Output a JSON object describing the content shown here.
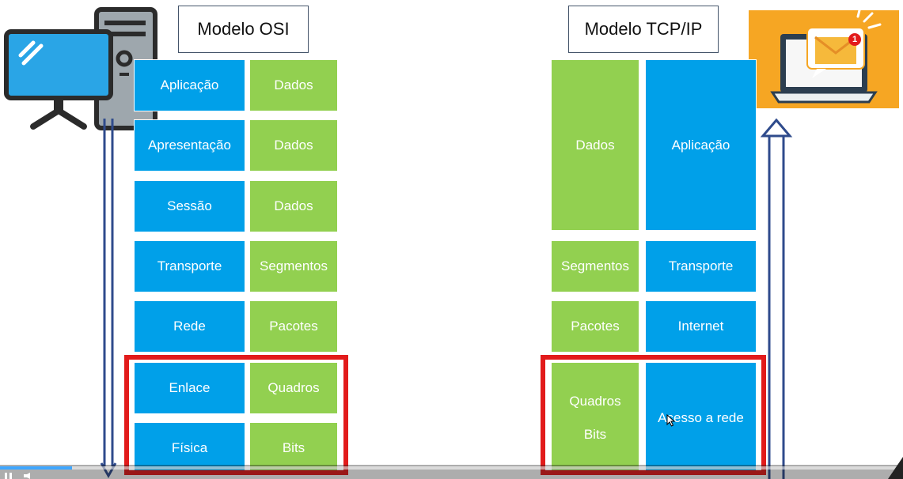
{
  "osi": {
    "title": "Modelo OSI",
    "rows": [
      {
        "layer": "Aplicação",
        "pdu": "Dados"
      },
      {
        "layer": "Apresentação",
        "pdu": "Dados"
      },
      {
        "layer": "Sessão",
        "pdu": "Dados"
      },
      {
        "layer": "Transporte",
        "pdu": "Segmentos"
      },
      {
        "layer": "Rede",
        "pdu": "Pacotes"
      },
      {
        "layer": "Enlace",
        "pdu": "Quadros"
      },
      {
        "layer": "Física",
        "pdu": "Bits"
      }
    ]
  },
  "tcpip": {
    "title": "Modelo TCP/IP",
    "rows": [
      {
        "pdu": "Dados",
        "layer": "Aplicação"
      },
      {
        "pdu": "Segmentos",
        "layer": "Transporte"
      },
      {
        "pdu": "Pacotes",
        "layer": "Internet"
      },
      {
        "pdu_line1": "Quadros",
        "pdu_line2": "Bits",
        "layer": "Acesso a rede"
      }
    ]
  },
  "notification": {
    "badge_count": "1"
  },
  "colors": {
    "layer": "#00a0e9",
    "pdu": "#92d050",
    "highlight": "#e21b1b",
    "arrow": "#2f4b8c",
    "laptop_bg": "#f6a623"
  },
  "icons": {
    "left": "desktop-computer-icon",
    "right": "laptop-mail-notification-icon"
  },
  "player": {
    "progress": 0.08
  }
}
